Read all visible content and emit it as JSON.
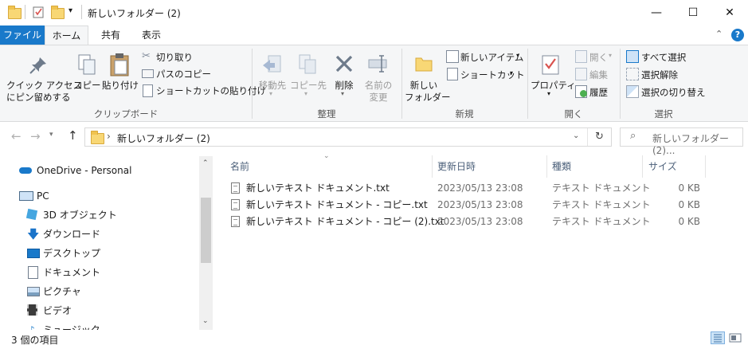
{
  "window": {
    "title": "新しいフォルダー (2)",
    "controls": {
      "minimize": "—",
      "maximize": "☐",
      "close": "✕"
    }
  },
  "tabs": [
    {
      "label": "ファイル"
    },
    {
      "label": "ホーム"
    },
    {
      "label": "共有"
    },
    {
      "label": "表示"
    }
  ],
  "ribbon": {
    "clipboard": {
      "pin": "クイック アクセス\nにピン留めする",
      "pin_line1": "クイック アクセス",
      "pin_line2": "にピン留めする",
      "copy": "コピー",
      "paste": "貼り付け",
      "cut": "切り取り",
      "copy_path": "パスのコピー",
      "paste_shortcut": "ショートカットの貼り付け",
      "group": "クリップボード"
    },
    "organize": {
      "move_to": "移動先",
      "copy_to": "コピー先",
      "delete": "削除",
      "rename_line1": "名前の",
      "rename_line2": "変更",
      "group": "整理"
    },
    "new": {
      "new_folder_line1": "新しい",
      "new_folder_line2": "フォルダー",
      "new_item": "新しいアイテム",
      "easy_access": "ショートカット",
      "group": "新規"
    },
    "open": {
      "properties": "プロパティ",
      "open": "開く",
      "edit": "編集",
      "history": "履歴",
      "group": "開く"
    },
    "select": {
      "select_all": "すべて選択",
      "select_none": "選択解除",
      "invert": "選択の切り替え",
      "group": "選択"
    }
  },
  "address": {
    "path": "新しいフォルダー (2)",
    "search_placeholder": "新しいフォルダー (2)..."
  },
  "sidebar": {
    "items": [
      {
        "label": "OneDrive - Personal"
      },
      {
        "label": "PC"
      },
      {
        "label": "3D オブジェクト"
      },
      {
        "label": "ダウンロード"
      },
      {
        "label": "デスクトップ"
      },
      {
        "label": "ドキュメント"
      },
      {
        "label": "ピクチャ"
      },
      {
        "label": "ビデオ"
      },
      {
        "label": "ミュージック"
      }
    ]
  },
  "file_list": {
    "columns": [
      "名前",
      "更新日時",
      "種類",
      "サイズ"
    ],
    "rows": [
      {
        "name": "新しいテキスト ドキュメント.txt",
        "modified": "2023/05/13 23:08",
        "type": "テキスト ドキュメント",
        "size": "0 KB"
      },
      {
        "name": "新しいテキスト ドキュメント - コピー.txt",
        "modified": "2023/05/13 23:08",
        "type": "テキスト ドキュメント",
        "size": "0 KB"
      },
      {
        "name": "新しいテキスト ドキュメント - コピー (2).txt",
        "modified": "2023/05/13 23:08",
        "type": "テキスト ドキュメント",
        "size": "0 KB"
      }
    ]
  },
  "status": {
    "count": "3 個の項目"
  },
  "colors": {
    "accent": "#1979ca",
    "folder": "#f8d775",
    "help": "#1979ca"
  }
}
